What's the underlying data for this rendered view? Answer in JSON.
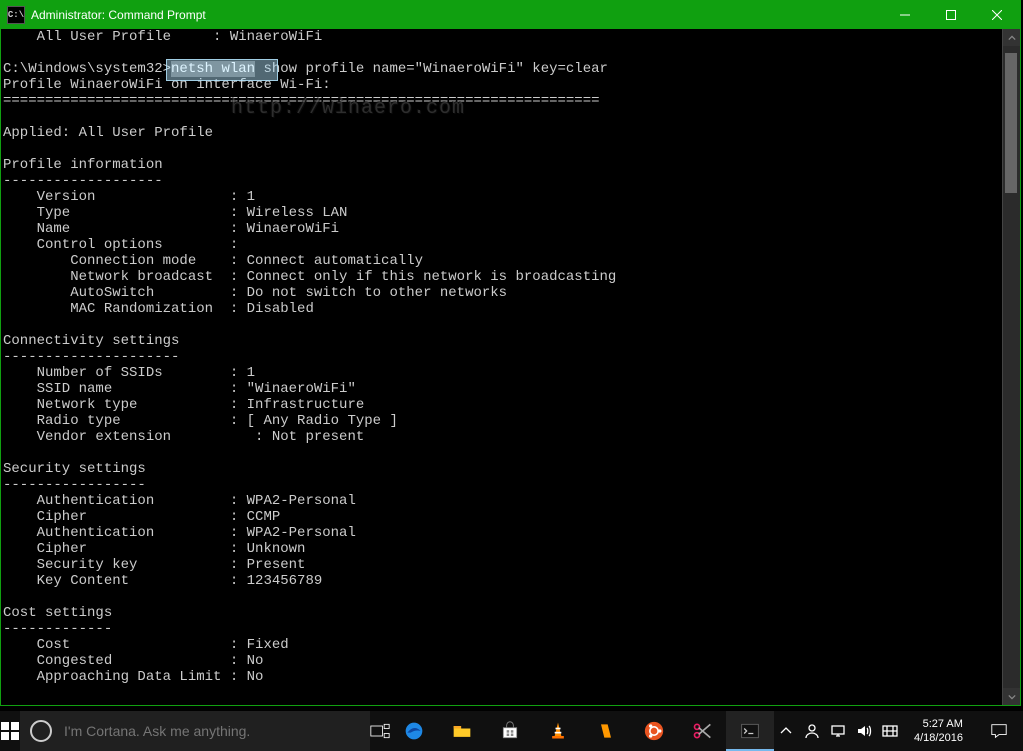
{
  "window": {
    "title": "Administrator: Command Prompt",
    "icon_label": "C:\\"
  },
  "console": {
    "prev_output": "    All User Profile     : WinaeroWiFi",
    "blank": "",
    "prompt_path": "C:\\Windows\\system32>",
    "cmd_highlight": "netsh wlan",
    "cmd_rest": " show profile name=\"WinaeroWiFi\" key=clear",
    "watermark_text": "http://winaero.com",
    "header_line": "Profile WinaeroWiFi on interface Wi-Fi:",
    "header_sep": "=======================================================================",
    "applied_line": "Applied: All User Profile",
    "sections": {
      "profile_info": {
        "title": "Profile information",
        "sep": "-------------------",
        "rows": [
          [
            "    Version                : ",
            "1"
          ],
          [
            "    Type                   : ",
            "Wireless LAN"
          ],
          [
            "    Name                   : ",
            "WinaeroWiFi"
          ],
          [
            "    Control options        :",
            ""
          ],
          [
            "        Connection mode    : ",
            "Connect automatically"
          ],
          [
            "        Network broadcast  : ",
            "Connect only if this network is broadcasting"
          ],
          [
            "        AutoSwitch         : ",
            "Do not switch to other networks"
          ],
          [
            "        MAC Randomization  : ",
            "Disabled"
          ]
        ]
      },
      "connectivity": {
        "title": "Connectivity settings",
        "sep": "---------------------",
        "rows": [
          [
            "    Number of SSIDs        : ",
            "1"
          ],
          [
            "    SSID name              : ",
            "\"WinaeroWiFi\""
          ],
          [
            "    Network type           : ",
            "Infrastructure"
          ],
          [
            "    Radio type             : ",
            "[ Any Radio Type ]"
          ],
          [
            "    Vendor extension          : ",
            "Not present"
          ]
        ]
      },
      "security": {
        "title": "Security settings",
        "sep": "-----------------",
        "rows": [
          [
            "    Authentication         : ",
            "WPA2-Personal"
          ],
          [
            "    Cipher                 : ",
            "CCMP"
          ],
          [
            "    Authentication         : ",
            "WPA2-Personal"
          ],
          [
            "    Cipher                 : ",
            "Unknown"
          ],
          [
            "    Security key           : ",
            "Present"
          ],
          [
            "    Key Content            : ",
            "123456789"
          ]
        ]
      },
      "cost": {
        "title": "Cost settings",
        "sep": "-------------",
        "rows": [
          [
            "    Cost                   : ",
            "Fixed"
          ],
          [
            "    Congested              : ",
            "No"
          ],
          [
            "    Approaching Data Limit : ",
            "No"
          ]
        ]
      }
    }
  },
  "cortana": {
    "placeholder": "I'm Cortana. Ask me anything."
  },
  "tray": {
    "time": "5:27 AM",
    "date": "4/18/2016"
  }
}
